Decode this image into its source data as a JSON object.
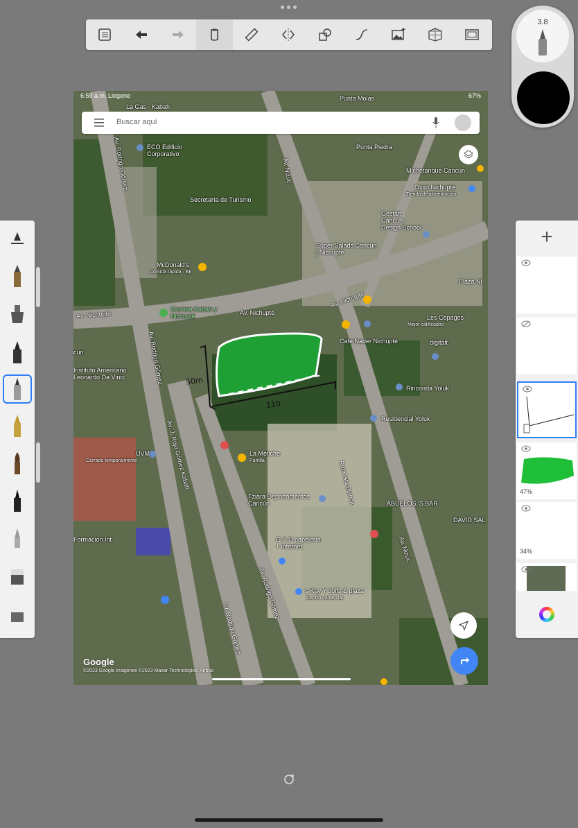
{
  "toolbar": {
    "items": [
      "gallery-icon",
      "undo-icon",
      "redo-icon",
      "fill-icon",
      "ruler-icon",
      "symmetry-icon",
      "shapes-icon",
      "curve-icon",
      "image-icon",
      "perspective-icon",
      "fullscreen-icon"
    ]
  },
  "brush": {
    "size": "3.8",
    "color": "#000000"
  },
  "left_tools": [
    "brush-settings-icon",
    "pencil-icon",
    "airbrush-icon",
    "marker-icon",
    "ballpoint-pen-icon",
    "fountain-pen-icon",
    "paint-brush-icon",
    "ink-brush-icon",
    "eraser-icon",
    "blender-icon",
    "smudge-icon"
  ],
  "layers": [
    {
      "name": "layer-1",
      "visible": true,
      "opacity": ""
    },
    {
      "name": "layer-2",
      "visible": false,
      "opacity": ""
    },
    {
      "name": "layer-3",
      "visible": true,
      "opacity": "",
      "selected": true
    },
    {
      "name": "layer-4",
      "visible": true,
      "opacity": "47%"
    },
    {
      "name": "layer-5",
      "visible": true,
      "opacity": "34%"
    },
    {
      "name": "layer-6",
      "visible": true,
      "opacity": ""
    }
  ],
  "map": {
    "status_time": "6:59 a.m.  Llegene",
    "status_right": "67%",
    "search_placeholder": "Buscar aquí",
    "labels": {
      "la_gas": "La Gas - Kabah",
      "punta_molas": "Punta Molas",
      "eco": "ECO Edificio Corporativo",
      "secretaria": "Secretaría de Turismo",
      "av_nizuc": "Av. Nizuc",
      "punta_piedra": "Punta Piedra",
      "michetanque": "Michetanque Cancún",
      "oxxo": "Oxxo Nichupté",
      "oxxo_sub": "Tienda de alimentación",
      "gestalt": "Gestalt Cancún Design School",
      "super_salads": "Super Salads Cancún | Nichupte",
      "mcdonalds": "McDonald's",
      "mcdonalds_sub": "Comida rápida · $$",
      "glorieta": "Glorieta Kabah y Nichupté",
      "av_nichupte_1": "Av. Nichupté",
      "av_nichupte_2": "Av. Nichupté",
      "av_nichupte_3": "Av. Nichupté",
      "plaza": "Plaza Ni",
      "cepages": "Les Cépages",
      "cepages_sub": "Mejor calificados",
      "cafe_nader": "Café Nader Nichupté",
      "digitalt": "digitalt",
      "av_rodrigo_1": "Av. Rodrigo Gómez",
      "av_rodrigo_2": "Av. Rodrigo Gómez",
      "av_rodrigo_3": "Av. Rodrigo Gómez",
      "av_rodrigo_4": "Av. Rodrigo Gómez",
      "instituto": "Instituto Americano Leonardo Da Vinci",
      "av_j_rojo": "Av. J. Rojo Gómez Kabah",
      "rinconda": "Rinconda Yoluk",
      "residencial": "Residencial Yoluk",
      "uvm": "UVM",
      "uvm_sub": "Cerrado temporalmente",
      "la_metiche": "La Metiche",
      "la_metiche_sub": "Parrilla",
      "ruta_isla": "Ruta Isla Blanca",
      "tziara": "Tziara Departamentos Cancún",
      "abuelos": "ABUELOS 'S BAR",
      "david": "DAVID SAL",
      "av_nizuc_2": "Av. Nizuc",
      "formacion": "Formación Int",
      "gd": "G & D papelería + internet",
      "kay": "s-Kay Y Joffs & plaza",
      "kay_sub": "Centro comercial",
      "cun": "cun",
      "google": "Google",
      "copyright": "©2023 Google Imágenes ©2023 Maxar Technologies, Airbus"
    },
    "annotations": {
      "height_label": "50m",
      "width_label": "110"
    }
  }
}
